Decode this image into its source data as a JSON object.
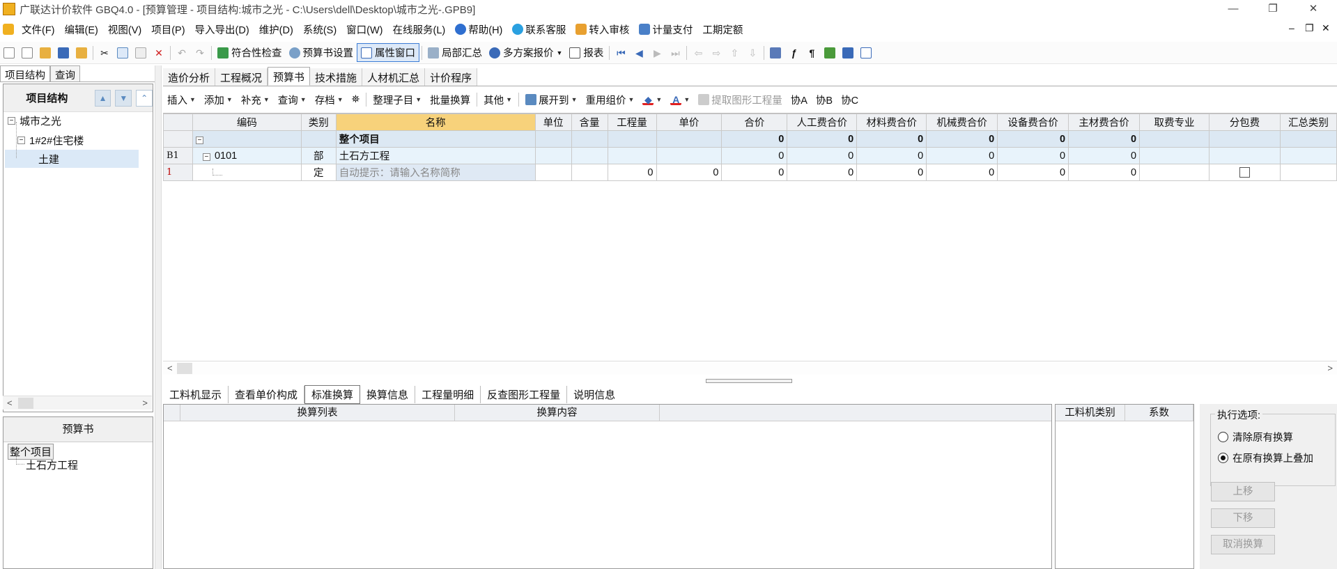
{
  "window": {
    "title": "广联达计价软件 GBQ4.0 - [预算管理 - 项目结构:城市之光 - C:\\Users\\dell\\Desktop\\城市之光-.GPB9]",
    "controls": [
      "—",
      "❐",
      "✕"
    ]
  },
  "menubar": {
    "items": [
      "文件(F)",
      "编辑(E)",
      "视图(V)",
      "项目(P)",
      "导入导出(D)",
      "维护(D)",
      "系统(S)",
      "窗口(W)",
      "在线服务(L)",
      "帮助(H)",
      "联系客服",
      "转入审核",
      "计量支付",
      "工期定额"
    ],
    "mdi_controls": [
      "–",
      "❐",
      "✕"
    ]
  },
  "toolbar": {
    "check": "符合性检查",
    "budget_settings": "预算书设置",
    "property_window": "属性窗口",
    "partial_summary": "局部汇总",
    "multi_quote": "多方案报价",
    "report": "报表"
  },
  "left": {
    "tabs": [
      "项目结构",
      "查询"
    ],
    "panel_title": "项目结构",
    "tree": [
      "城市之光",
      "1#2#住宅楼",
      "土建"
    ],
    "budget_title": "预算书",
    "budget_tree": [
      "整个项目",
      "土石方工程"
    ]
  },
  "main_tabs": [
    "造价分析",
    "工程概况",
    "预算书",
    "技术措施",
    "人材机汇总",
    "计价程序"
  ],
  "subbar": {
    "insert": "插入",
    "add": "添加",
    "supplement": "补充",
    "query": "查询",
    "save": "存档",
    "organize": "整理子目",
    "batch_convert": "批量换算",
    "other": "其他",
    "expand_to": "展开到",
    "reuse": "重用组价",
    "extract": "提取图形工程量",
    "assist_a": "协A",
    "assist_b": "协B",
    "assist_c": "协C"
  },
  "grid": {
    "columns": [
      "编码",
      "类别",
      "名称",
      "单位",
      "含量",
      "工程量",
      "单价",
      "合价",
      "人工费合价",
      "材料费合价",
      "机械费合价",
      "设备费合价",
      "主材费合价",
      "取费专业",
      "分包费",
      "汇总类别"
    ],
    "rows": [
      {
        "rowhdr": "",
        "code": "",
        "type": "",
        "name": "整个项目",
        "unit": "",
        "content": "",
        "qty": "",
        "price": "",
        "total": "0",
        "labor": "0",
        "material": "0",
        "machine": "0",
        "equipment": "0",
        "main_material": "0",
        "fee": "",
        "sub": "",
        "cat": ""
      },
      {
        "rowhdr": "B1",
        "code": "0101",
        "type": "部",
        "name": "土石方工程",
        "unit": "",
        "content": "",
        "qty": "",
        "price": "",
        "total": "0",
        "labor": "0",
        "material": "0",
        "machine": "0",
        "equipment": "0",
        "main_material": "0",
        "fee": "",
        "sub": "",
        "cat": ""
      },
      {
        "rowhdr": "1",
        "code": "",
        "type": "定",
        "name": "自动提示：请输入名称简称",
        "unit": "",
        "content": "",
        "qty": "0",
        "price": "0",
        "total": "0",
        "labor": "0",
        "material": "0",
        "machine": "0",
        "equipment": "0",
        "main_material": "0",
        "fee": "",
        "sub": "",
        "cat": ""
      }
    ]
  },
  "bottom_tabs": [
    "工料机显示",
    "查看单价构成",
    "标准换算",
    "换算信息",
    "工程量明细",
    "反查图形工程量",
    "说明信息"
  ],
  "conversion": {
    "col_list": "换算列表",
    "col_content": "换算内容"
  },
  "coef": {
    "col_category": "工料机类别",
    "col_factor": "系数"
  },
  "exec": {
    "legend": "执行选项:",
    "opt_clear": "清除原有换算",
    "opt_stack": "在原有换算上叠加",
    "selected": "opt_stack",
    "btn_up": "上移",
    "btn_down": "下移",
    "btn_cancel": "取消换算"
  },
  "colors": {
    "header_highlight": "#f7d27b",
    "row_selected": "#dce8f3",
    "accent": "#3a7bd5"
  }
}
